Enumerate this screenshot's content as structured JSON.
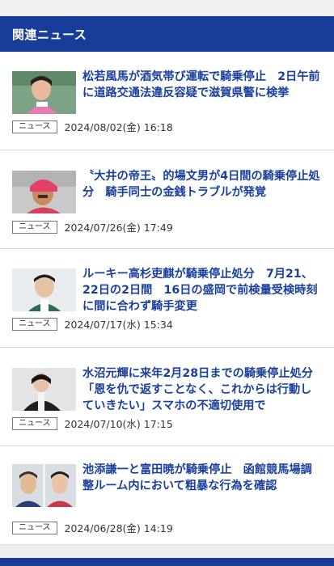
{
  "section": {
    "title": "関連ニュース"
  },
  "news": [
    {
      "title": "松若風馬が酒気帯び運転で騎乗停止　2日午前に道路交通法違反容疑で滋賀県警に検挙",
      "badge": "ニュース",
      "date": "2024/08/02(金) 16:18"
    },
    {
      "title": "〝大井の帝王〟的場文男が4日間の騎乗停止処分　騎手同士の金銭トラブルが発覚",
      "badge": "ニュース",
      "date": "2024/07/26(金) 17:49"
    },
    {
      "title": "ルーキー高杉吏麒が騎乗停止処分　7月21、22日の2日間　16日の盛岡で前検量受検時刻に間に合わず騎手変更",
      "badge": "ニュース",
      "date": "2024/07/17(水) 15:34"
    },
    {
      "title": "水沼元輝に来年2月28日までの騎乗停止処分「恩を仇で返すことなく、これからは行動していきたい」スマホの不適切使用で",
      "badge": "ニュース",
      "date": "2024/07/10(水) 17:15"
    },
    {
      "title": "池添謙一と富田暁が騎乗停止　函館競馬場調整ルーム内において粗暴な行為を確認",
      "badge": "ニュース",
      "date": "2024/06/28(金) 14:19"
    }
  ],
  "colors": {
    "header_bg": "#173d99",
    "title": "#1a3f9c"
  }
}
